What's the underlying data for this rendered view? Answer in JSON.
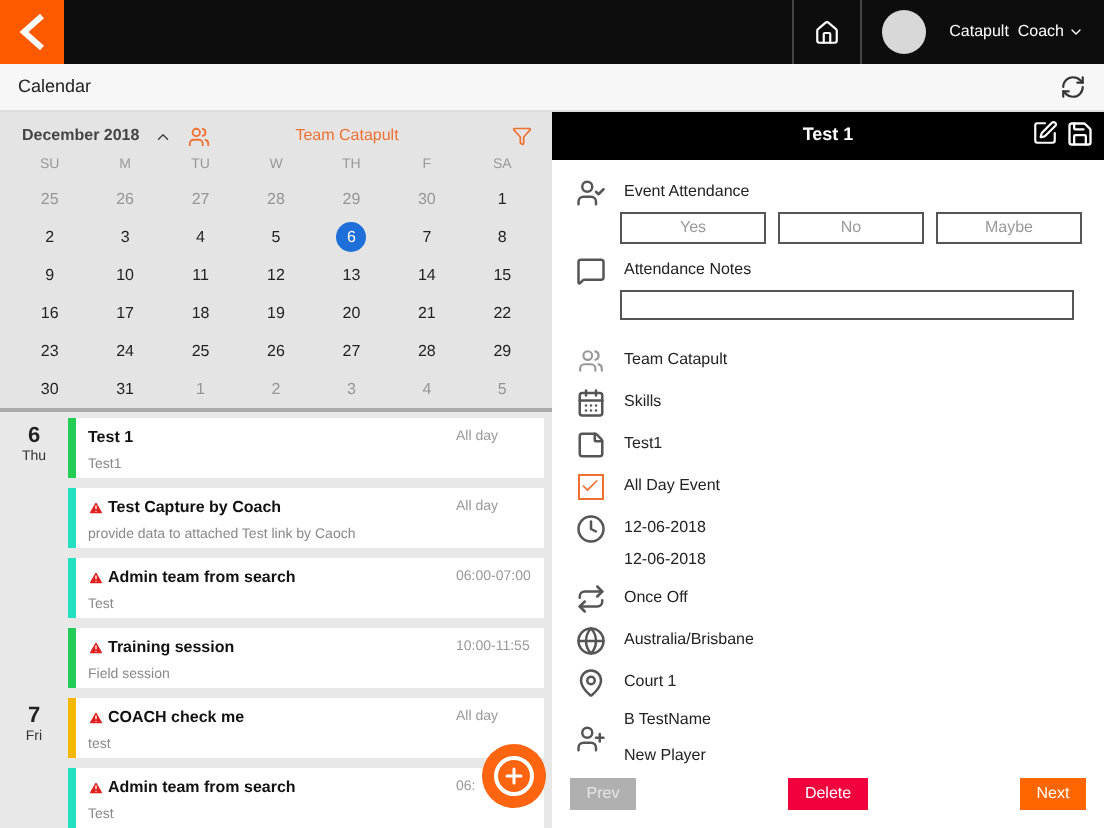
{
  "top_bar": {
    "user_name": "Catapult  Coach"
  },
  "header": {
    "title": "Calendar"
  },
  "calendar": {
    "month": "December 2018",
    "team": "Team Catapult",
    "weekdays": [
      "SU",
      "M",
      "TU",
      "W",
      "TH",
      "F",
      "SA"
    ],
    "days": [
      {
        "label": "25",
        "in_month": false,
        "selected": false
      },
      {
        "label": "26",
        "in_month": false,
        "selected": false
      },
      {
        "label": "27",
        "in_month": false,
        "selected": false
      },
      {
        "label": "28",
        "in_month": false,
        "selected": false
      },
      {
        "label": "29",
        "in_month": false,
        "selected": false
      },
      {
        "label": "30",
        "in_month": false,
        "selected": false
      },
      {
        "label": "1",
        "in_month": true,
        "selected": false
      },
      {
        "label": "2",
        "in_month": true,
        "selected": false
      },
      {
        "label": "3",
        "in_month": true,
        "selected": false
      },
      {
        "label": "4",
        "in_month": true,
        "selected": false
      },
      {
        "label": "5",
        "in_month": true,
        "selected": false
      },
      {
        "label": "6",
        "in_month": true,
        "selected": true
      },
      {
        "label": "7",
        "in_month": true,
        "selected": false
      },
      {
        "label": "8",
        "in_month": true,
        "selected": false
      },
      {
        "label": "9",
        "in_month": true,
        "selected": false
      },
      {
        "label": "10",
        "in_month": true,
        "selected": false
      },
      {
        "label": "11",
        "in_month": true,
        "selected": false
      },
      {
        "label": "12",
        "in_month": true,
        "selected": false
      },
      {
        "label": "13",
        "in_month": true,
        "selected": false
      },
      {
        "label": "14",
        "in_month": true,
        "selected": false
      },
      {
        "label": "15",
        "in_month": true,
        "selected": false
      },
      {
        "label": "16",
        "in_month": true,
        "selected": false
      },
      {
        "label": "17",
        "in_month": true,
        "selected": false
      },
      {
        "label": "18",
        "in_month": true,
        "selected": false
      },
      {
        "label": "19",
        "in_month": true,
        "selected": false
      },
      {
        "label": "20",
        "in_month": true,
        "selected": false
      },
      {
        "label": "21",
        "in_month": true,
        "selected": false
      },
      {
        "label": "22",
        "in_month": true,
        "selected": false
      },
      {
        "label": "23",
        "in_month": true,
        "selected": false
      },
      {
        "label": "24",
        "in_month": true,
        "selected": false
      },
      {
        "label": "25",
        "in_month": true,
        "selected": false
      },
      {
        "label": "26",
        "in_month": true,
        "selected": false
      },
      {
        "label": "27",
        "in_month": true,
        "selected": false
      },
      {
        "label": "28",
        "in_month": true,
        "selected": false
      },
      {
        "label": "29",
        "in_month": true,
        "selected": false
      },
      {
        "label": "30",
        "in_month": true,
        "selected": false
      },
      {
        "label": "31",
        "in_month": true,
        "selected": false
      },
      {
        "label": "1",
        "in_month": false,
        "selected": false
      },
      {
        "label": "2",
        "in_month": false,
        "selected": false
      },
      {
        "label": "3",
        "in_month": false,
        "selected": false
      },
      {
        "label": "4",
        "in_month": false,
        "selected": false
      },
      {
        "label": "5",
        "in_month": false,
        "selected": false
      }
    ]
  },
  "agenda": [
    {
      "day": "6",
      "weekday": "Thu",
      "events": [
        {
          "title": "Test 1",
          "subtitle": "Test1",
          "time": "All day",
          "color": "#22cc55",
          "warning": false
        },
        {
          "title": "Test Capture by Coach",
          "subtitle": "provide data to attached Test link by Caoch",
          "time": "All day",
          "color": "#22e0c0",
          "warning": true
        },
        {
          "title": "Admin team from search",
          "subtitle": "Test",
          "time": "06:00-07:00",
          "color": "#22e0c0",
          "warning": true
        },
        {
          "title": "Training session",
          "subtitle": "Field session",
          "time": "10:00-11:55",
          "color": "#22cc55",
          "warning": true
        }
      ]
    },
    {
      "day": "7",
      "weekday": "Fri",
      "events": [
        {
          "title": "COACH check me",
          "subtitle": "test",
          "time": "All day",
          "color": "#f5b800",
          "warning": true
        },
        {
          "title": "Admin team from search",
          "subtitle": "Test",
          "time": "06:",
          "color": "#22e0c0",
          "warning": true
        }
      ]
    }
  ],
  "detail": {
    "title": "Test 1",
    "attendance_label": "Event Attendance",
    "attendance_options": [
      {
        "label": "Yes",
        "selected": false
      },
      {
        "label": "No",
        "selected": false
      },
      {
        "label": "Maybe",
        "selected": false
      }
    ],
    "notes_label": "Attendance Notes",
    "team": "Team Catapult",
    "category": "Skills",
    "description": "Test1",
    "all_day": {
      "label": "All Day Event",
      "checked": true
    },
    "start_date": "12-06-2018",
    "end_date": "12-06-2018",
    "recurrence": "Once Off",
    "timezone": "Australia/Brisbane",
    "location": "Court 1",
    "players": [
      "B TestName",
      "New Player"
    ],
    "buttons": [
      {
        "label": "Prev",
        "kind": "prev",
        "disabled": true
      },
      {
        "label": "Delete",
        "kind": "delete",
        "disabled": false
      },
      {
        "label": "Next",
        "kind": "next",
        "disabled": false
      }
    ]
  }
}
